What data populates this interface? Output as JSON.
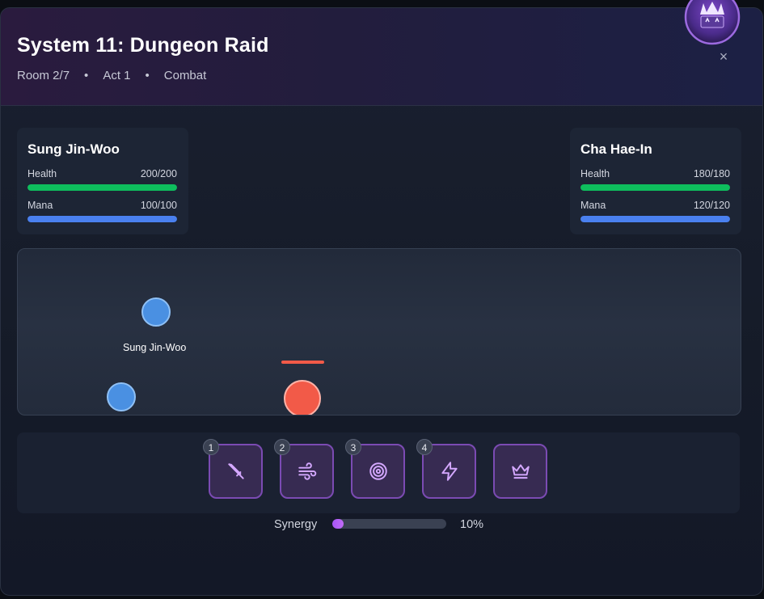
{
  "header": {
    "title": "System 11: Dungeon Raid",
    "room": "Room 2/7",
    "act": "Act 1",
    "phase": "Combat",
    "separator": "•",
    "close_icon": "×"
  },
  "party": [
    {
      "name": "Sung Jin-Woo",
      "health_label": "Health",
      "health": 200,
      "health_max": 200,
      "health_text": "200/200",
      "mana_label": "Mana",
      "mana": 100,
      "mana_max": 100,
      "mana_text": "100/100"
    },
    {
      "name": "Cha Hae-In",
      "health_label": "Health",
      "health": 180,
      "health_max": 180,
      "health_text": "180/180",
      "mana_label": "Mana",
      "mana": 120,
      "mana_max": 120,
      "mana_text": "120/120"
    }
  ],
  "arena": {
    "player_label": "Sung Jin-Woo",
    "enemy_health_fraction": 1.0
  },
  "skills": [
    {
      "hotkey": "1",
      "icon": "sword-icon"
    },
    {
      "hotkey": "2",
      "icon": "wind-icon"
    },
    {
      "hotkey": "3",
      "icon": "target-icon"
    },
    {
      "hotkey": "4",
      "icon": "lightning-icon"
    },
    {
      "hotkey": "",
      "icon": "crown-icon"
    }
  ],
  "synergy": {
    "label": "Synergy",
    "percent": 10,
    "value_text": "10%"
  },
  "colors": {
    "health": "#0ebe5d",
    "mana": "#4a80ef",
    "ally": "#4a90e2",
    "enemy": "#f25a48",
    "accent": "#a855f7"
  }
}
